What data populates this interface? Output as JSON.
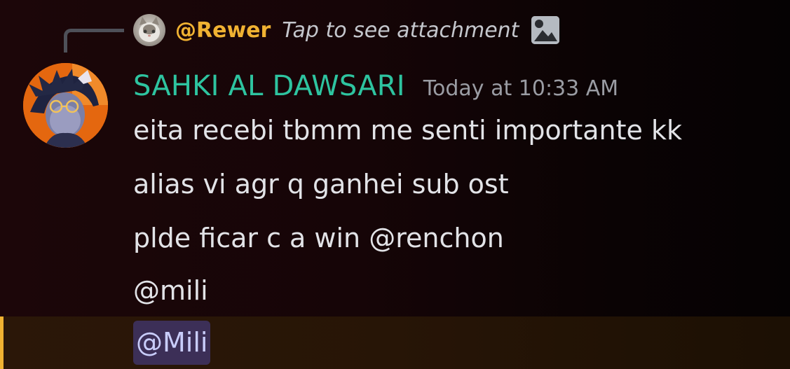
{
  "reply": {
    "username": "@Rewer",
    "preview": "Tap to see attachment",
    "attachment_icon": "image-icon"
  },
  "message": {
    "author": "SAHKI AL DAWSARI",
    "timestamp": "Today at 10:33 AM",
    "lines": [
      "eita recebi tbmm me senti importante kk",
      "alias vi agr q ganhei sub ost",
      "plde ficar c a win @renchon",
      "@mili"
    ],
    "highlighted_mention": "@Mili"
  },
  "colors": {
    "author": "#2ec4a0",
    "reply_username": "#f0b232",
    "mention_bar": "#f0b232",
    "mention_pill": "#3c2f57",
    "mention_text": "#c9cdfb"
  }
}
